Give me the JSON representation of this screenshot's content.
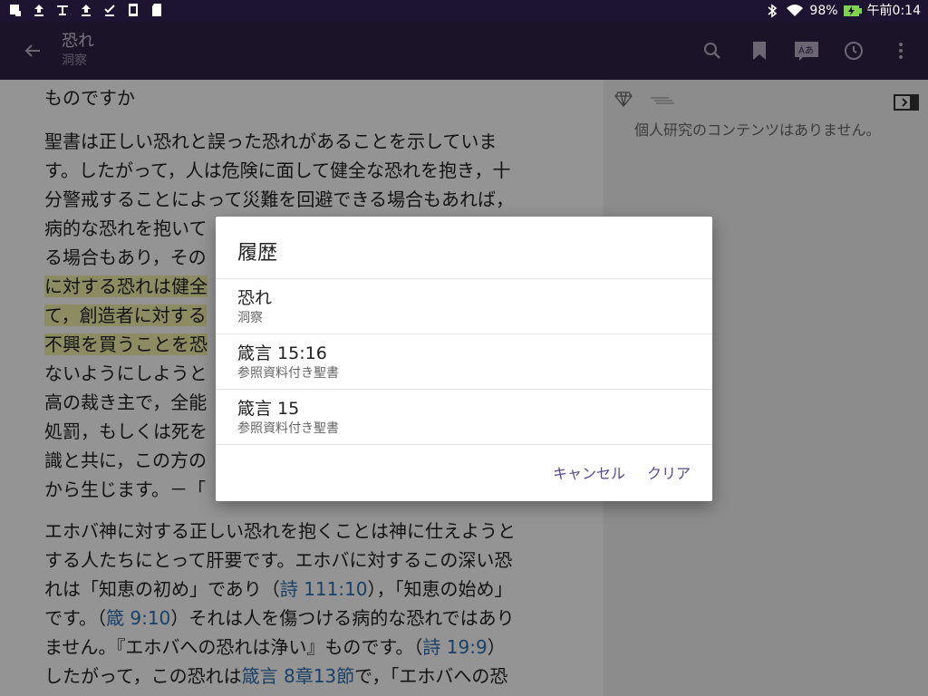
{
  "status": {
    "battery": "98%",
    "time": "午前0:14"
  },
  "appbar": {
    "title": "恐れ",
    "subtitle": "洞察"
  },
  "main": {
    "lines_top": [
      "ものですか"
    ],
    "para1": [
      "聖書は正しい恐れと誤った恐れがあることを示していま",
      "す。したがって，人は危険に面して健全な恐れを抱き，十",
      "分警戒することによって災難を回避できる場合もあれば，",
      "病的な恐れを抱いて",
      "る場合もあり，その",
      "に対する恐れは健全",
      "て，創造者に対する",
      "不興を買うことを恐",
      "ないようにしようと",
      "高の裁き主で，全能",
      "処罰，もしくは死を",
      "識と共に，この方の",
      "から生じます。－「"
    ],
    "para2_line1": "エホバ神に対する正しい恐れを抱くことは神に仕えようと",
    "para2_line2": "する人たちにとって肝要です。エホバに対するこの深い恐",
    "para2_line3a": "れは「知恵の初め」であり（",
    "para2_link1": "詩 111:10",
    "para2_line3b": "），「知恵の始め」",
    "para2_line4a": "です。（",
    "para2_link2": "箴 9:10",
    "para2_line4b": "）それは人を傷つける病的な恐れではあり",
    "para2_line5a": "ません。『エホバへの恐れは浄い』ものです。（",
    "para2_link3": "詩 19:9",
    "para2_line5b": "）",
    "para2_line6a": "したがって，この恐れは",
    "para2_link4": "箴言 8章13節",
    "para2_line6b": "で，「エホバへの恐"
  },
  "side": {
    "empty_text": "個人研究のコンテンツはありません。"
  },
  "dialog": {
    "title": "履歴",
    "items": [
      {
        "title": "恐れ",
        "sub": "洞察"
      },
      {
        "title": "箴言 15:16",
        "sub": "参照資料付き聖書"
      },
      {
        "title": "箴言 15",
        "sub": "参照資料付き聖書"
      }
    ],
    "cancel": "キャンセル",
    "clear": "クリア"
  },
  "colors": {
    "appbar": "#2f2445",
    "statusbar": "#1c1430",
    "highlight": "#f3f0a8",
    "link": "#2f6fb0",
    "accent": "#5a4a8a"
  }
}
